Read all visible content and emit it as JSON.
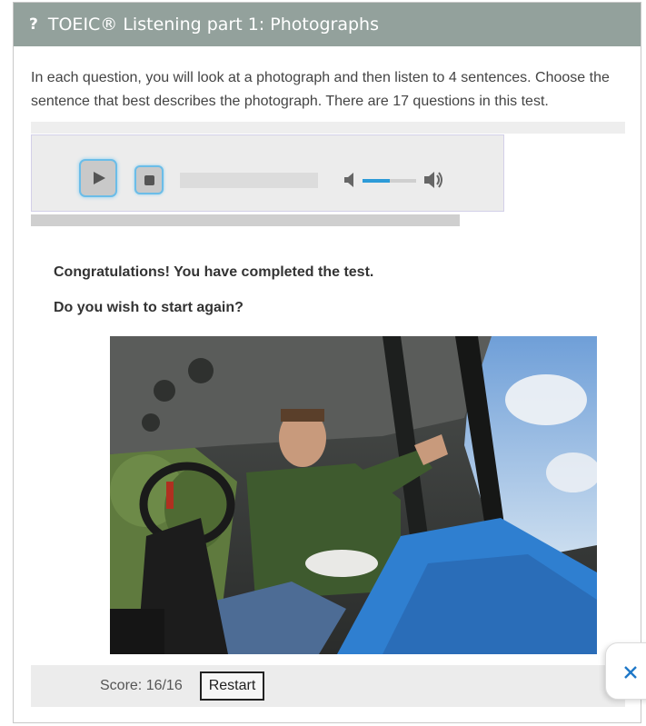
{
  "header": {
    "icon": "question-icon",
    "icon_glyph": "?",
    "title": "TOEIC® Listening part 1: Photographs"
  },
  "intro": {
    "text": "In each question, you will look at a photograph and then listen to 4 sentences. Choose the sentence that best describes the photograph. There are 17 questions in this test."
  },
  "player": {
    "play_icon": "play-icon",
    "stop_icon": "stop-icon",
    "mute_icon": "speaker-mute-icon",
    "volume_icon": "speaker-loud-icon",
    "volume_level": 0.5,
    "progress": 0,
    "accent_color": "#2d9bd8"
  },
  "result": {
    "message": "Congratulations! You have completed the test.",
    "prompt": "Do you wish to start again?"
  },
  "footer": {
    "score_text": "Score: 16/16",
    "restart_label": "Restart"
  },
  "close": {
    "icon": "close-icon",
    "color": "#1e78c8"
  },
  "colors": {
    "header_bg": "#93a19c",
    "header_text": "#ffffff"
  }
}
